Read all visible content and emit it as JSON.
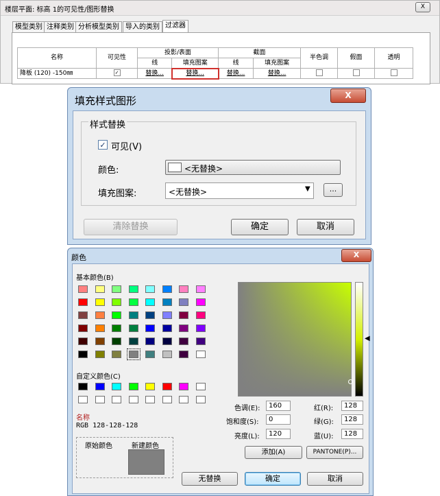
{
  "vg_dialog": {
    "title": "楼层平面: 标高 1的可见性/图形替换",
    "close": "X",
    "tabs": [
      "模型类别",
      "注释类别",
      "分析模型类别",
      "导入的类别",
      "过滤器"
    ],
    "headers": {
      "name": "名称",
      "visibility": "可见性",
      "projection": "投影/表面",
      "cut": "截面",
      "line": "线",
      "pattern": "填充图案",
      "halftone": "半色调",
      "ghost": "假面",
      "transparent": "透明"
    },
    "row": {
      "name": "降板 (120) -150㎜",
      "checked": "✓",
      "replace": "替换..."
    }
  },
  "fill_dialog": {
    "title": "填充样式图形",
    "close": "X",
    "group": "样式替换",
    "visible_label": "可见(V)",
    "visible_checked": "✓",
    "color_label": "颜色:",
    "color_value": "<无替换>",
    "pattern_label": "填充图案:",
    "pattern_value": "<无替换>",
    "browse": "...",
    "clear_btn": "清除替换",
    "ok_btn": "确定",
    "cancel_btn": "取消"
  },
  "color_dialog": {
    "title": "颜色",
    "close": "X",
    "basic_label": "基本颜色(B)",
    "custom_label": "自定义颜色(C)",
    "basic_colors": [
      "#ff8080",
      "#ffff80",
      "#80ff80",
      "#00ff80",
      "#80ffff",
      "#0080ff",
      "#ff80c0",
      "#ff80ff",
      "#ff0000",
      "#ffff00",
      "#80ff00",
      "#00ff40",
      "#00ffff",
      "#0080c0",
      "#8080c0",
      "#ff00ff",
      "#804040",
      "#ff8040",
      "#00ff00",
      "#008080",
      "#004080",
      "#8080ff",
      "#800040",
      "#ff0080",
      "#800000",
      "#ff8000",
      "#008000",
      "#008040",
      "#0000ff",
      "#0000a0",
      "#800080",
      "#8000ff",
      "#400000",
      "#804000",
      "#004000",
      "#004040",
      "#000080",
      "#000040",
      "#400040",
      "#400080",
      "#000000",
      "#808000",
      "#808040",
      "#808080",
      "#408080",
      "#c0c0c0",
      "#400040",
      "#ffffff"
    ],
    "custom_colors": [
      "#000000",
      "#0000ff",
      "#00ffff",
      "#00ff00",
      "#ffff00",
      "#ff0000",
      "#ff00ff",
      "#ffffff",
      "#ffffff",
      "#ffffff",
      "#ffffff",
      "#ffffff",
      "#ffffff",
      "#ffffff",
      "#ffffff",
      "#ffffff"
    ],
    "name_label": "名称",
    "rgb_text": "RGB 128-128-128",
    "original_label": "原始颜色",
    "new_label": "新建颜色",
    "new_color": "#808080",
    "hue_label": "色调(E):",
    "hue": "160",
    "sat_label": "饱和度(S):",
    "sat": "0",
    "lum_label": "亮度(L):",
    "lum": "120",
    "red_label": "红(R):",
    "red": "128",
    "green_label": "绿(G):",
    "green": "128",
    "blue_label": "蓝(U):",
    "blue": "128",
    "add_btn": "添加(A)",
    "pantone_btn": "PANTONE(P)...",
    "none_btn": "无替换",
    "ok_btn": "确定",
    "cancel_btn": "取消"
  }
}
